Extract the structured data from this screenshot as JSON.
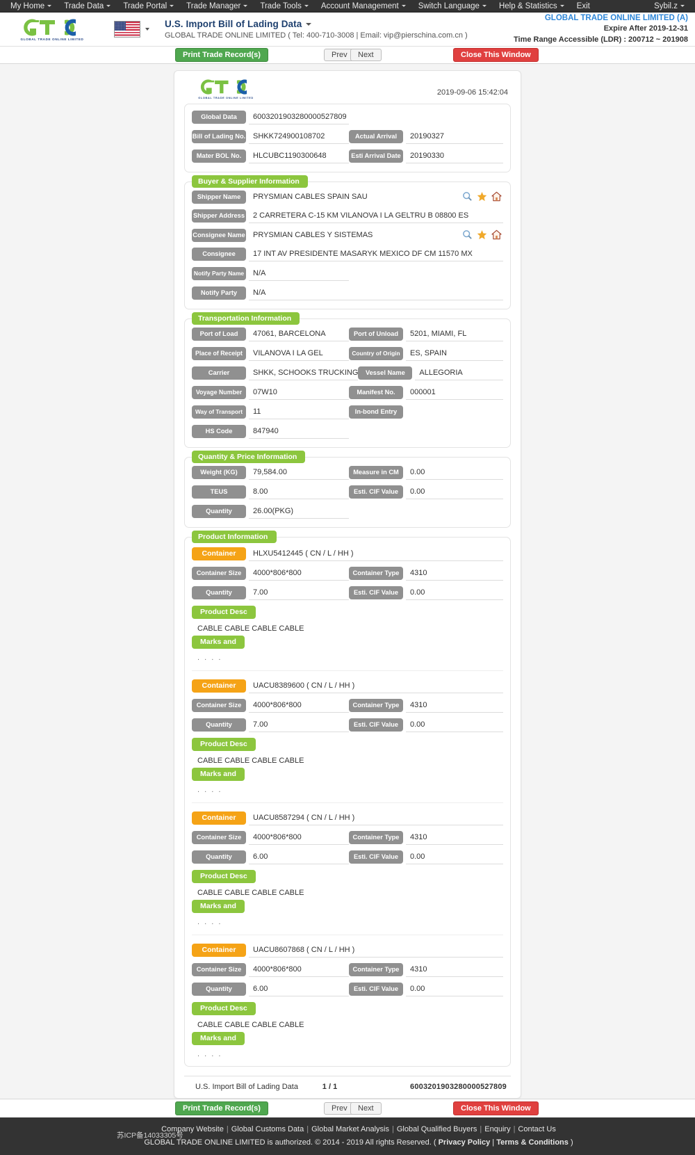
{
  "topnav": {
    "items": [
      {
        "label": "My Home",
        "caret": true
      },
      {
        "label": "Trade Data",
        "caret": true
      },
      {
        "label": "Trade Portal",
        "caret": true
      },
      {
        "label": "Trade Manager",
        "caret": true
      },
      {
        "label": "Trade Tools",
        "caret": true
      },
      {
        "label": "Account Management",
        "caret": true
      },
      {
        "label": "Switch Language",
        "caret": true
      },
      {
        "label": "Help & Statistics",
        "caret": true
      },
      {
        "label": "Exit",
        "caret": false
      }
    ],
    "user": {
      "label": "Sybil.z",
      "caret": true
    }
  },
  "header": {
    "logo_text": "GTO",
    "logo_sub": "GLOBAL  TRADE  ONLINE  LIMITED",
    "flag_icon": "us-flag-icon",
    "title": "U.S. Import Bill of Lading Data",
    "subtitle": "GLOBAL TRADE ONLINE LIMITED ( Tel: 400-710-3008 | Email: vip@pierschina.com.cn )",
    "account_name": "GLOBAL TRADE ONLINE LIMITED (A)",
    "expire": "Expire After 2019-12-31",
    "time_range": "Time Range Accessible (LDR) : 200712 ~ 201908"
  },
  "toolbar": {
    "print_label": "Print Trade Record(s)",
    "prev_label": "Prev",
    "next_label": "Next",
    "close_label": "Close This Window"
  },
  "document": {
    "logo_text": "GTO",
    "logo_sub": "GLOBAL  TRADE  ONLINE  LIMITED",
    "timestamp": "2019-09-06 15:42:04",
    "identity": {
      "global_data_label": "Global Data",
      "global_data_value": "6003201903280000527809",
      "bol_label": "Bill of Lading No.",
      "bol_value": "SHKK724900108702",
      "actual_arrival_label": "Actual Arrival",
      "actual_arrival_value": "20190327",
      "master_bol_label": "Mater BOL No.",
      "master_bol_value": "HLCUBC1190300648",
      "esti_arrival_label": "Esti Arrival Date",
      "esti_arrival_value": "20190330"
    },
    "buyer_supplier": {
      "legend": "Buyer & Supplier Information",
      "shipper_name_label": "Shipper Name",
      "shipper_name_value": "PRYSMIAN CABLES SPAIN SAU",
      "shipper_address_label": "Shipper Address",
      "shipper_address_value": "2 CARRETERA C-15 KM VILANOVA I LA GELTRU B 08800 ES",
      "consignee_name_label": "Consignee Name",
      "consignee_name_value": "PRYSMIAN CABLES Y SISTEMAS",
      "consignee_label": "Consignee",
      "consignee_value": "17 INT AV PRESIDENTE MASARYK MEXICO DF CM 11570 MX",
      "notify_party_name_label": "Notify Party Name",
      "notify_party_name_value": "N/A",
      "notify_party_label": "Notify Party",
      "notify_party_value": "N/A"
    },
    "transportation": {
      "legend": "Transportation Information",
      "port_of_load_label": "Port of Load",
      "port_of_load_value": "47061, BARCELONA",
      "port_of_unload_label": "Port of Unload",
      "port_of_unload_value": "5201, MIAMI, FL",
      "place_of_receipt_label": "Place of Receipt",
      "place_of_receipt_value": "VILANOVA I LA GEL",
      "country_of_origin_label": "Country of Origin",
      "country_of_origin_value": "ES, SPAIN",
      "carrier_label": "Carrier",
      "carrier_value": "SHKK, SCHOOKS TRUCKING",
      "vessel_name_label": "Vessel Name",
      "vessel_name_value": "ALLEGORIA",
      "voyage_number_label": "Voyage Number",
      "voyage_number_value": "07W10",
      "manifest_no_label": "Manifest No.",
      "manifest_no_value": "000001",
      "way_of_transport_label": "Way of Transport",
      "way_of_transport_value": "11",
      "in_bond_entry_label": "In-bond Entry",
      "in_bond_entry_value": "",
      "hs_code_label": "HS Code",
      "hs_code_value": "847940"
    },
    "quantity_price": {
      "legend": "Quantity & Price Information",
      "weight_label": "Weight (KG)",
      "weight_value": "79,584.00",
      "measure_label": "Measure in CM",
      "measure_value": "0.00",
      "teus_label": "TEUS",
      "teus_value": "8.00",
      "cif_label": "Esti. CIF Value",
      "cif_value": "0.00",
      "quantity_label": "Quantity",
      "quantity_value": "26.00(PKG)"
    },
    "product": {
      "legend": "Product Information",
      "container_label": "Container",
      "container_size_label": "Container Size",
      "container_type_label": "Container Type",
      "quantity_label": "Quantity",
      "cif_label": "Esti. CIF Value",
      "product_desc_label": "Product Desc",
      "marks_label": "Marks and",
      "marks_value": ". . . .",
      "containers": [
        {
          "container": "HLXU5412445 ( CN / L / HH )",
          "size": "4000*806*800",
          "type": "4310",
          "quantity": "7.00",
          "cif": "0.00",
          "desc": "CABLE CABLE CABLE CABLE"
        },
        {
          "container": "UACU8389600 ( CN / L / HH )",
          "size": "4000*806*800",
          "type": "4310",
          "quantity": "7.00",
          "cif": "0.00",
          "desc": "CABLE CABLE CABLE CABLE"
        },
        {
          "container": "UACU8587294 ( CN / L / HH )",
          "size": "4000*806*800",
          "type": "4310",
          "quantity": "6.00",
          "cif": "0.00",
          "desc": "CABLE CABLE CABLE CABLE"
        },
        {
          "container": "UACU8607868 ( CN / L / HH )",
          "size": "4000*806*800",
          "type": "4310",
          "quantity": "6.00",
          "cif": "0.00",
          "desc": "CABLE CABLE CABLE CABLE"
        }
      ]
    },
    "footer": {
      "title": "U.S. Import Bill of Lading Data",
      "page": "1 / 1",
      "record_id": "6003201903280000527809"
    }
  },
  "site_footer": {
    "icp": "苏ICP备14033305号",
    "links": [
      "Company Website",
      "Global Customs Data",
      "Global Market Analysis",
      "Global Qualified Buyers",
      "Enquiry",
      "Contact Us"
    ],
    "copyright_prefix": "GLOBAL TRADE ONLINE LIMITED is authorized. © 2014 - 2019 All rights Reserved.  (",
    "privacy": "Privacy Policy",
    "terms": "Terms & Conditions",
    "copyright_suffix": ")"
  },
  "colors": {
    "nav_bg": "#333333",
    "green": "#8cc63e",
    "orange": "#f5a316",
    "grey_label": "#909090",
    "btn_green": "#4fa74f",
    "btn_red": "#e0403f",
    "accent_blue": "#2f87d8"
  }
}
